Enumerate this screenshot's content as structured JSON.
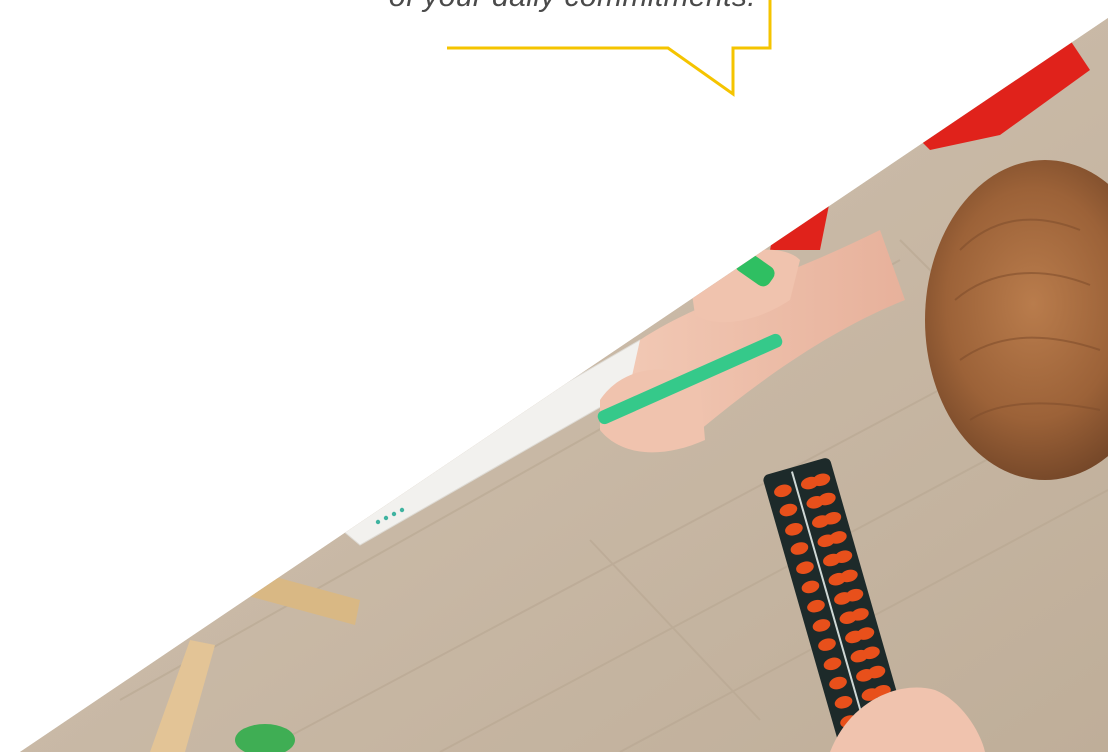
{
  "quote": {
    "text": "of your daily commitments."
  },
  "colors": {
    "accent_yellow": "#f5c400",
    "quote_text": "#4a4a4a",
    "floor": "#cdbfae",
    "shirt_red": "#e0221b",
    "abacus_bead": "#e8501b",
    "hair": "#a5683e",
    "pen_green": "#35c98a"
  },
  "image": {
    "subject": "child-with-abacus-photo"
  }
}
